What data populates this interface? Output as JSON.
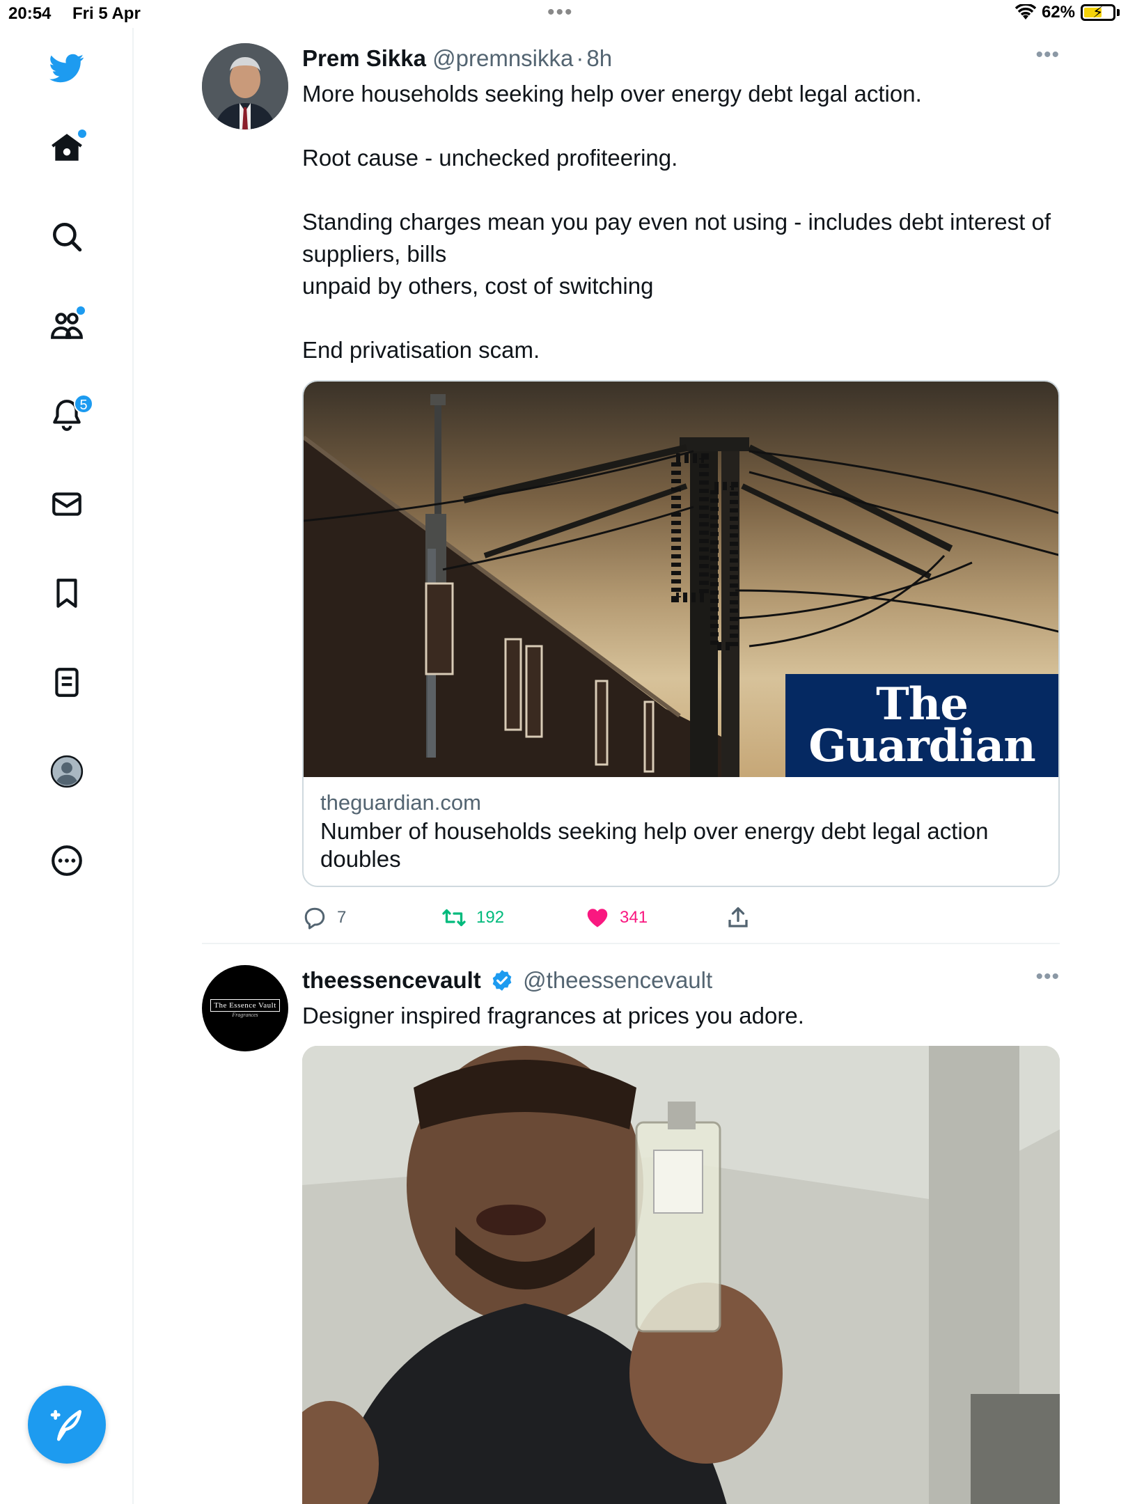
{
  "status_bar": {
    "time": "20:54",
    "date": "Fri 5 Apr",
    "battery": "62%",
    "battery_level": 0.62
  },
  "sidebar": {
    "items": [
      {
        "name": "twitter-logo",
        "icon": "twitter-bird-icon"
      },
      {
        "name": "home",
        "icon": "home-icon"
      },
      {
        "name": "explore",
        "icon": "search-icon"
      },
      {
        "name": "communities",
        "icon": "communities-icon"
      },
      {
        "name": "notifications",
        "icon": "bell-icon",
        "badge": "5"
      },
      {
        "name": "messages",
        "icon": "mail-icon"
      },
      {
        "name": "bookmarks",
        "icon": "bookmark-icon"
      },
      {
        "name": "lists",
        "icon": "list-icon"
      },
      {
        "name": "profile",
        "icon": "avatar-icon"
      },
      {
        "name": "more",
        "icon": "more-circle-icon"
      }
    ],
    "compose_icon": "compose-feather-icon"
  },
  "colors": {
    "accent": "#1d9bf0",
    "retweet": "#00ba7c",
    "like": "#f91880",
    "muted": "#536471",
    "guardian_blue": "#052962"
  },
  "tweets": [
    {
      "display_name": "Prem Sikka",
      "handle": "@premnsikka",
      "separator": "·",
      "time": "8h",
      "text": "More households seeking help over energy debt legal action.\n\nRoot cause - unchecked profiteering.\n\nStanding charges mean you pay even not using - includes debt interest of suppliers, bills\nunpaid by others, cost of switching\n\nEnd privatisation scam.",
      "card": {
        "logo_line1": "The",
        "logo_line2": "Guardian",
        "domain": "theguardian.com",
        "title": "Number of households seeking help over energy debt legal action doubles"
      },
      "actions": {
        "replies": "7",
        "retweets": "192",
        "likes": "341"
      }
    },
    {
      "display_name": "theessencevault",
      "handle": "@theessencevault",
      "avatar_text": "The Essence Vault",
      "avatar_subtext": "Fragrances",
      "text": "Designer inspired fragrances at prices you adore."
    }
  ]
}
